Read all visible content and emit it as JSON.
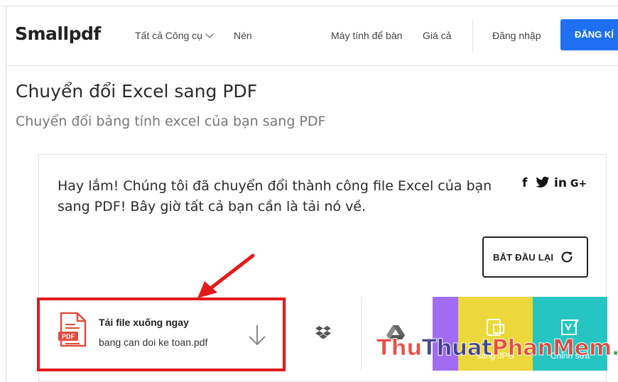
{
  "header": {
    "logo": "Smallpdf",
    "nav": {
      "tools_label": "Tất cả Công cụ",
      "compress_label": "Nén",
      "desktop_label": "Máy tính để bàn",
      "pricing_label": "Giá cả",
      "login_label": "Đăng nhập",
      "signup_label": "ĐĂNG KÍ"
    },
    "signup_color": "#1e6ff1"
  },
  "page": {
    "title": "Chuyển đổi Excel sang PDF",
    "subtitle": "Chuyển đổi bảng tính excel của bạn sang PDF"
  },
  "card": {
    "message": "Hay lắm! Chúng tôi đã chuyển đổi thành công file Excel của bạn sang PDF! Bây giờ tất cả bạn cần là tải nó về.",
    "share": {
      "facebook": "f",
      "twitter": "twitter-icon",
      "linkedin": "in",
      "google_plus": "G+"
    },
    "restart_label": "BẮT ĐẦU LẠI",
    "download": {
      "title": "Tải file xuống ngay",
      "filename": "bang can doi ke toan.pdf",
      "file_badge": "PDF"
    },
    "tiles": {
      "yellow_label": "sang JPG",
      "teal_label": "Chỉnh sửa",
      "purple_color": "#a16cf1",
      "yellow_color": "#ecd83a",
      "teal_color": "#26c5c2"
    }
  },
  "annotation": {
    "box_color": "#e21a1a"
  },
  "watermark": {
    "part1": "Thu",
    "part2": "Thuat",
    "part3": "PhanMem",
    "part4": ".vn"
  }
}
